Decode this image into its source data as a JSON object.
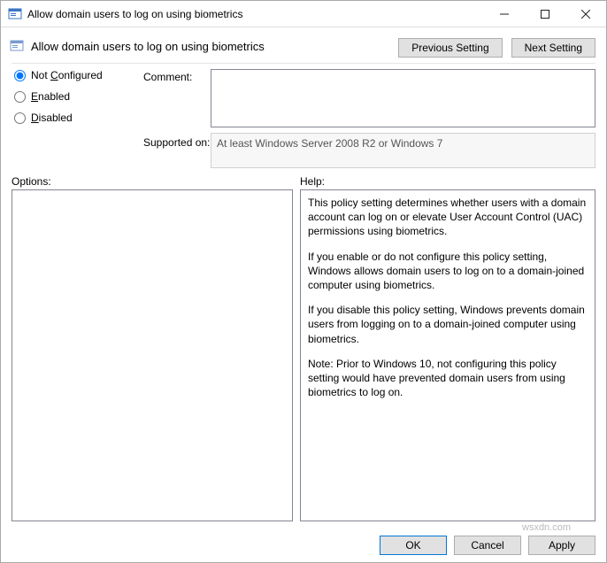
{
  "window": {
    "title": "Allow domain users to log on using biometrics",
    "header_title": "Allow domain users to log on using biometrics",
    "minimize_tooltip": "Minimize",
    "maximize_tooltip": "Maximize",
    "close_tooltip": "Close"
  },
  "nav": {
    "previous": "Previous Setting",
    "next": "Next Setting"
  },
  "radio": {
    "not_configured": "Not Configured",
    "enabled": "Enabled",
    "disabled": "Disabled"
  },
  "labels": {
    "comment": "Comment:",
    "supported_on": "Supported on:",
    "options": "Options:",
    "help": "Help:"
  },
  "fields": {
    "comment": "",
    "supported_on": "At least Windows Server 2008 R2 or Windows 7"
  },
  "help": {
    "p1": "This policy setting determines whether users with a domain account can log on or elevate User Account Control (UAC) permissions using biometrics.",
    "p2": "If you enable or do not configure this policy setting, Windows allows domain users to log on to a domain-joined computer using biometrics.",
    "p3": "If you disable this policy setting, Windows prevents domain users from logging on to a domain-joined computer using biometrics.",
    "p4": "Note: Prior to Windows 10, not configuring this policy setting would have prevented domain users from using biometrics to log on."
  },
  "buttons": {
    "ok": "OK",
    "cancel": "Cancel",
    "apply": "Apply"
  },
  "watermark": "wsxdn.com"
}
